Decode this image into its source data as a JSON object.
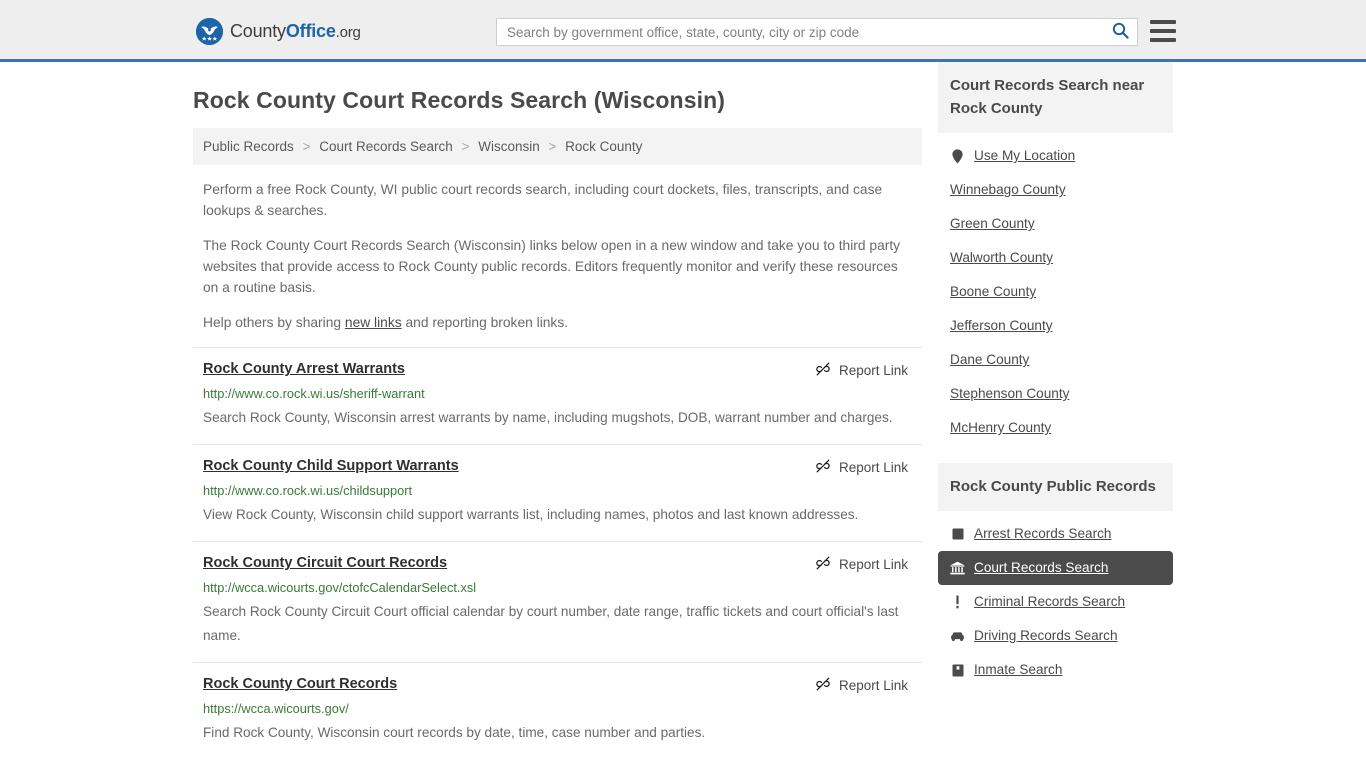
{
  "header": {
    "logo": {
      "part1": "County",
      "part2": "Office",
      "part3": ".org",
      "icon": "eagle-seal-icon"
    },
    "search": {
      "placeholder": "Search by government office, state, county, city or zip code",
      "value": "",
      "button_icon": "search-icon"
    },
    "menu_icon": "hamburger-menu-icon",
    "accent_color": "#3a76ab",
    "background_color": "#eeeeee"
  },
  "page_title": "Rock County Court Records Search (Wisconsin)",
  "breadcrumb": {
    "items": [
      {
        "label": "Public Records"
      },
      {
        "label": "Court Records Search"
      },
      {
        "label": "Wisconsin"
      },
      {
        "label": "Rock County"
      }
    ],
    "separator": ">"
  },
  "intro": {
    "p1": "Perform a free Rock County, WI public court records search, including court dockets, files, transcripts, and case lookups & searches.",
    "p2": "The Rock County Court Records Search (Wisconsin) links below open in a new window and take you to third party websites that provide access to Rock County public records. Editors frequently monitor and verify these resources on a routine basis.",
    "p3_before": "Help others by sharing ",
    "p3_link": "new links",
    "p3_after": " and reporting broken links."
  },
  "report_link": {
    "label": "Report Link",
    "icon": "broken-link-icon"
  },
  "results": [
    {
      "title": "Rock County Arrest Warrants",
      "url": "http://www.co.rock.wi.us/sheriff-warrant",
      "description": "Search Rock County, Wisconsin arrest warrants by name, including mugshots, DOB, warrant number and charges."
    },
    {
      "title": "Rock County Child Support Warrants",
      "url": "http://www.co.rock.wi.us/childsupport",
      "description": "View Rock County, Wisconsin child support warrants list, including names, photos and last known addresses."
    },
    {
      "title": "Rock County Circuit Court Records",
      "url": "http://wcca.wicourts.gov/ctofcCalendarSelect.xsl",
      "description": "Search Rock County Circuit Court official calendar by court number, date range, traffic tickets and court official's last name."
    },
    {
      "title": "Rock County Court Records",
      "url": "https://wcca.wicourts.gov/",
      "description": "Find Rock County, Wisconsin court records by date, time, case number and parties."
    }
  ],
  "sidebar": {
    "nearby": {
      "heading": "Court Records Search near Rock County",
      "items": [
        {
          "label": "Use My Location",
          "icon": "map-pin-icon"
        },
        {
          "label": "Winnebago County",
          "icon": ""
        },
        {
          "label": "Green County",
          "icon": ""
        },
        {
          "label": "Walworth County",
          "icon": ""
        },
        {
          "label": "Boone County",
          "icon": ""
        },
        {
          "label": "Jefferson County",
          "icon": ""
        },
        {
          "label": "Dane County",
          "icon": ""
        },
        {
          "label": "Stephenson County",
          "icon": ""
        },
        {
          "label": "McHenry County",
          "icon": ""
        }
      ]
    },
    "public_records": {
      "heading": "Rock County Public Records",
      "items": [
        {
          "label": "Arrest Records Search",
          "icon": "square-badge-icon",
          "active": false
        },
        {
          "label": "Court Records Search",
          "icon": "courthouse-icon",
          "active": true
        },
        {
          "label": "Criminal Records Search",
          "icon": "exclamation-icon",
          "active": false
        },
        {
          "label": "Driving Records Search",
          "icon": "car-icon",
          "active": false
        },
        {
          "label": "Inmate Search",
          "icon": "inmate-icon",
          "active": false
        }
      ],
      "active_background": "#4b4b4b"
    }
  }
}
